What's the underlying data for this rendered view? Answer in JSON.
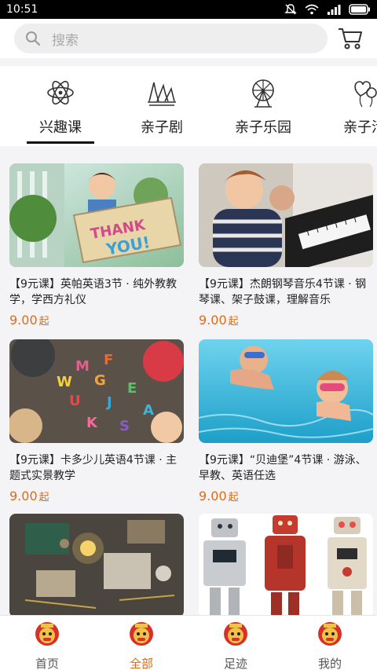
{
  "status_bar": {
    "time": "10:51"
  },
  "search": {
    "placeholder": "搜索"
  },
  "categories": [
    {
      "label": "兴趣课",
      "icon": "atom-icon",
      "active": true
    },
    {
      "label": "亲子剧",
      "icon": "opera-house-icon",
      "active": false
    },
    {
      "label": "亲子乐园",
      "icon": "ferris-wheel-icon",
      "active": false
    },
    {
      "label": "亲子活",
      "icon": "balloon-icon",
      "active": false
    }
  ],
  "products": [
    {
      "title": "【9元课】英帕英语3节 · 纯外教教学，学西方礼仪",
      "price": "9.00",
      "suffix": "起",
      "image": "boy-thank-you-sign"
    },
    {
      "title": "【9元课】杰朗钢琴音乐4节课 · 钢琴课、架子鼓课，理解音乐",
      "price": "9.00",
      "suffix": "起",
      "image": "child-playing-piano"
    },
    {
      "title": "【9元课】卡多少儿英语4节课 · 主题式实景教学",
      "price": "9.00",
      "suffix": "起",
      "image": "kids-letter-blocks"
    },
    {
      "title": "【9元课】“贝迪堡”4节课 · 游泳、早教、英语任选",
      "price": "9.00",
      "suffix": "起",
      "image": "kids-swimming"
    },
    {
      "title": "",
      "price": "",
      "suffix": "",
      "image": "electronics-workbench"
    },
    {
      "title": "",
      "price": "",
      "suffix": "",
      "image": "toy-robots"
    }
  ],
  "tabs": [
    {
      "label": "首页",
      "active": false
    },
    {
      "label": "全部",
      "active": true
    },
    {
      "label": "足迹",
      "active": false
    },
    {
      "label": "我的",
      "active": false
    }
  ],
  "colors": {
    "accent": "#e06a1c",
    "active_underline": "#111111"
  }
}
